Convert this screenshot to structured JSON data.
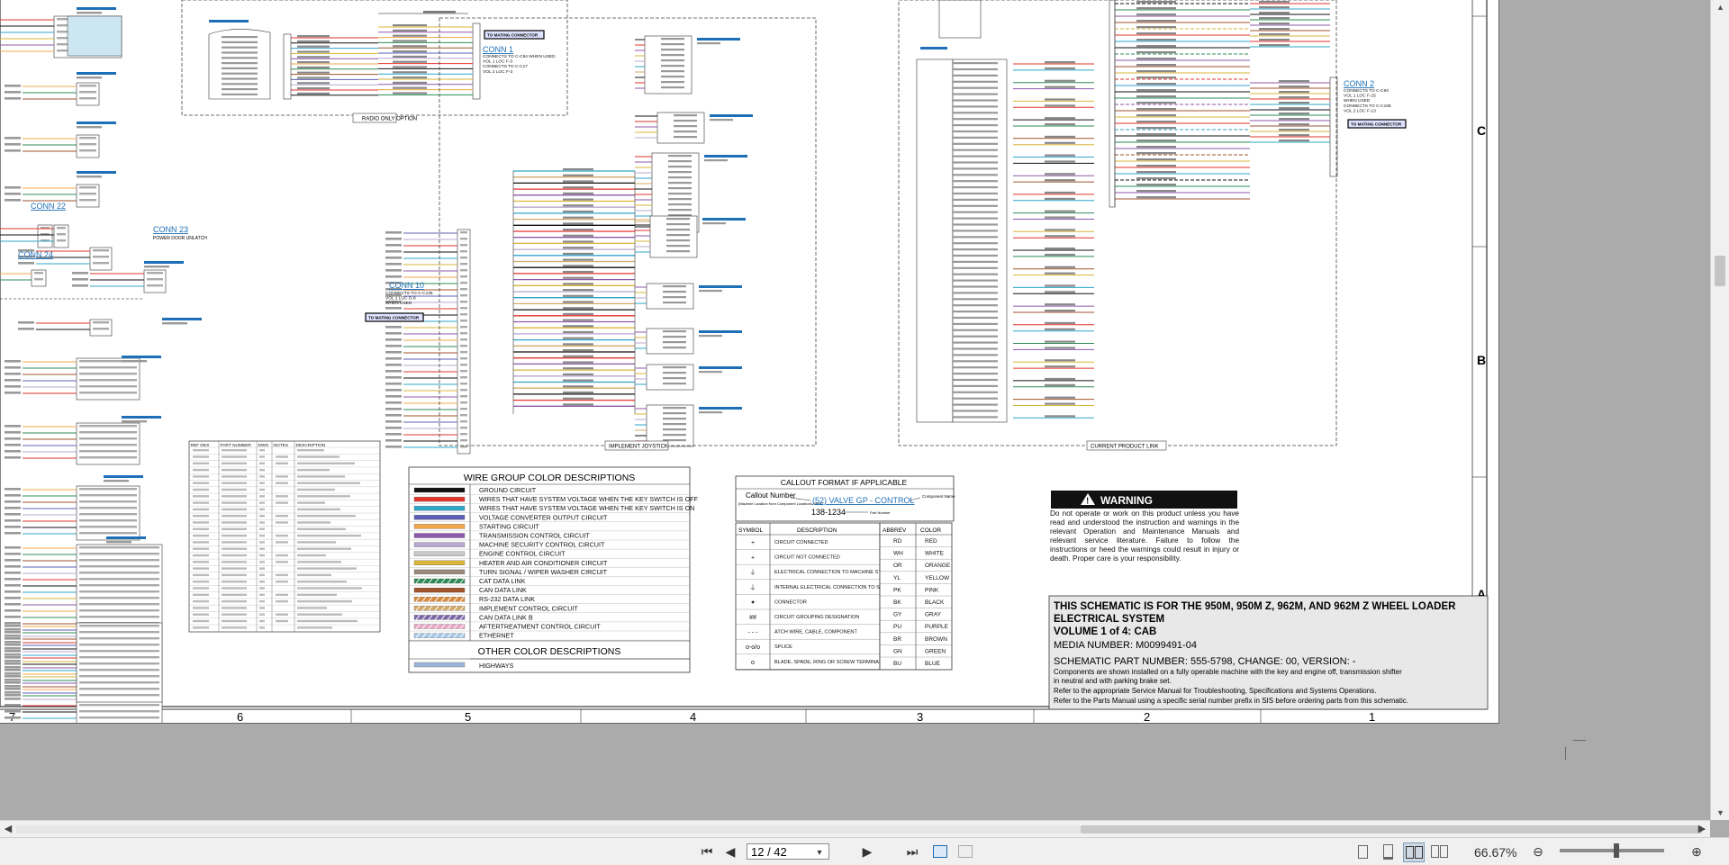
{
  "document": {
    "page_current": "12 / 42",
    "page_total_label": "42",
    "zoom": "66.67%"
  },
  "schematic": {
    "columns": [
      "7",
      "6",
      "5",
      "4",
      "3",
      "2",
      "1"
    ],
    "rows": [
      "C",
      "B",
      "A"
    ],
    "connectors": {
      "conn1": {
        "name": "CONN 1",
        "lines": [
          "CONNECTS TO C-C94 WHEN USED",
          "VOL 1 LOC F-3",
          "CONNECTS TO C-C17",
          "VOL 2 LOC F-3"
        ],
        "tag": "TO MATING CONNECTOR"
      },
      "conn2": {
        "name": "CONN 2",
        "lines": [
          "CONNECTS TO C-C94",
          "VOL 1 LOC F-15",
          "WHEN USED",
          "CONNECTS TO C-C108",
          "VOL 2 LOC F-13"
        ],
        "tag": "TO MATING CONNECTOR"
      },
      "conn10": {
        "name": "CONN 10",
        "lines": [
          "CONNECTS TO C-C135",
          "VOL 1 LOC D-8",
          "WHEN USED"
        ],
        "tag": "TO MATING CONNECTOR"
      },
      "conn22": {
        "name": "CONN 22"
      },
      "conn23": {
        "name": "CONN 23",
        "lines": [
          "POWER DOOR UNLATCH"
        ]
      },
      "conn24": {
        "name": "CONN 24"
      }
    },
    "group_labels": {
      "radio": "RADIO ONLY OPTION",
      "joystick": "IMPLEMENT JOYSTICK",
      "product_link": "CURRENT PRODUCT LINK"
    },
    "wire_color_table": {
      "title": "WIRE GROUP COLOR DESCRIPTIONS",
      "items": [
        {
          "color": "#111111",
          "label": "GROUND CIRCUIT"
        },
        {
          "color": "#e2342d",
          "label": "WIRES THAT HAVE SYSTEM VOLTAGE WHEN THE KEY SWITCH IS OFF"
        },
        {
          "color": "#2fa7c9",
          "label": "WIRES THAT HAVE SYSTEM VOLTAGE WHEN THE KEY SWITCH IS ON"
        },
        {
          "color": "#5c5fb4",
          "label": "VOLTAGE CONVERTER OUTPUT CIRCUIT"
        },
        {
          "color": "#f1a74a",
          "label": "STARTING CIRCUIT"
        },
        {
          "color": "#8e58a8",
          "label": "TRANSMISSION CONTROL CIRCUIT"
        },
        {
          "color": "#b9a7cf",
          "label": "MACHINE SECURITY CONTROL CIRCUIT"
        },
        {
          "color": "#c9c9c9",
          "label": "ENGINE CONTROL CIRCUIT"
        },
        {
          "color": "#d9b638",
          "label": "HEATER AND AIR CONDITIONER CIRCUIT"
        },
        {
          "color": "#9a8a7a",
          "label": "TURN SIGNAL / WIPER WASHER CIRCUIT"
        },
        {
          "color": "#2e8b57",
          "label": "CAT DATA LINK"
        },
        {
          "color": "#a0522d",
          "label": "CAN DATA LINK"
        },
        {
          "color": "#d98a3c",
          "label": "RS-232 DATA LINK"
        },
        {
          "color": "#d4a96a",
          "label": "IMPLEMENT CONTROL CIRCUIT"
        },
        {
          "color": "#7b68a8",
          "label": "CAN DATA LINK B"
        },
        {
          "color": "#e8a8c8",
          "label": "AFTERTREATMENT CONTROL CIRCUIT"
        },
        {
          "color": "#a8c8e8",
          "label": "ETHERNET"
        }
      ],
      "other_title": "OTHER COLOR DESCRIPTIONS",
      "other_items": [
        {
          "color": "#9ab5d6",
          "label": "HIGHWAYS"
        }
      ]
    },
    "callout": {
      "title": "CALLOUT FORMAT IF APPLICABLE",
      "number_label": "Callout Number",
      "number_note": "(Machine Location from Component Locations Table)",
      "example": "(52) VALVE GP - CONTROL",
      "part": "138-1234",
      "part_label": "Part Number",
      "component_label": "Component Name"
    },
    "symbol_table": {
      "headers": [
        "SYMBOL",
        "DESCRIPTION"
      ],
      "rows": [
        {
          "sym": "+",
          "desc": "CIRCUIT CONNECTED"
        },
        {
          "sym": "+",
          "desc": "CIRCUIT NOT CONNECTED"
        },
        {
          "sym": "⏚",
          "desc": "ELECTRICAL CONNECTION TO MACHINE STRUCTURE"
        },
        {
          "sym": "⏚",
          "desc": "INTERNAL ELECTRICAL CONNECTION TO SURFACE OF COMPONENT"
        },
        {
          "sym": "✦",
          "desc": "CONNECTOR"
        },
        {
          "sym": "##",
          "desc": "CIRCUIT GROUPING DESIGNATION"
        },
        {
          "sym": "- - -",
          "desc": "ATCH WIRE, CABLE, COMPONENT"
        },
        {
          "sym": "o-o/o",
          "desc": "SPLICE"
        },
        {
          "sym": "o",
          "desc": "BLADE, SPADE, RING OR SCREW TERMINAL"
        }
      ]
    },
    "color_abbrev": {
      "headers": [
        "ABBREV",
        "COLOR"
      ],
      "rows": [
        [
          "RD",
          "RED"
        ],
        [
          "WH",
          "WHITE"
        ],
        [
          "OR",
          "ORANGE"
        ],
        [
          "YL",
          "YELLOW"
        ],
        [
          "PK",
          "PINK"
        ],
        [
          "BK",
          "BLACK"
        ],
        [
          "GY",
          "GRAY"
        ],
        [
          "PU",
          "PURPLE"
        ],
        [
          "BR",
          "BROWN"
        ],
        [
          "GN",
          "GREEN"
        ],
        [
          "BU",
          "BLUE"
        ]
      ]
    },
    "ref_table": {
      "headers": [
        "REF DES",
        "PART NUMBER",
        "DWG",
        "NOTES",
        "DESCRIPTION"
      ]
    },
    "warning": {
      "title": "WARNING",
      "text": "Do not operate or work on this product unless you have read and understood the instruction and warnings in the relevant Operation and Maintenance Manuals and relevant service literature. Failure to follow the instructions or heed the warnings could result in injury or death. Proper care is your responsibility."
    },
    "title_block": {
      "line1": "THIS SCHEMATIC IS FOR THE 950M, 950M Z, 962M, AND 962M Z WHEEL LOADER",
      "line2": "ELECTRICAL SYSTEM",
      "line3": "VOLUME 1 of 4: CAB",
      "line4": "MEDIA NUMBER: M0099491-04",
      "line5": "SCHEMATIC PART NUMBER: 555-5798, CHANGE: 00, VERSION: -",
      "line6": "Components are shown installed on a fully operable machine with the key and engine off, transmission shifter",
      "line7": "in neutral and with parking brake set.",
      "line8": "Refer to the appropriate Service Manual for Troubleshooting, Specifications and Systems Operations.",
      "line9": "Refer to the Parts Manual using a specific serial number prefix in SIS before ordering parts from this schematic."
    }
  },
  "icons": {
    "first_page": "first-page-icon",
    "prev_page": "prev-page-icon",
    "next_page": "next-page-icon",
    "last_page": "last-page-icon",
    "back": "back-view-icon",
    "forward": "forward-view-icon"
  }
}
